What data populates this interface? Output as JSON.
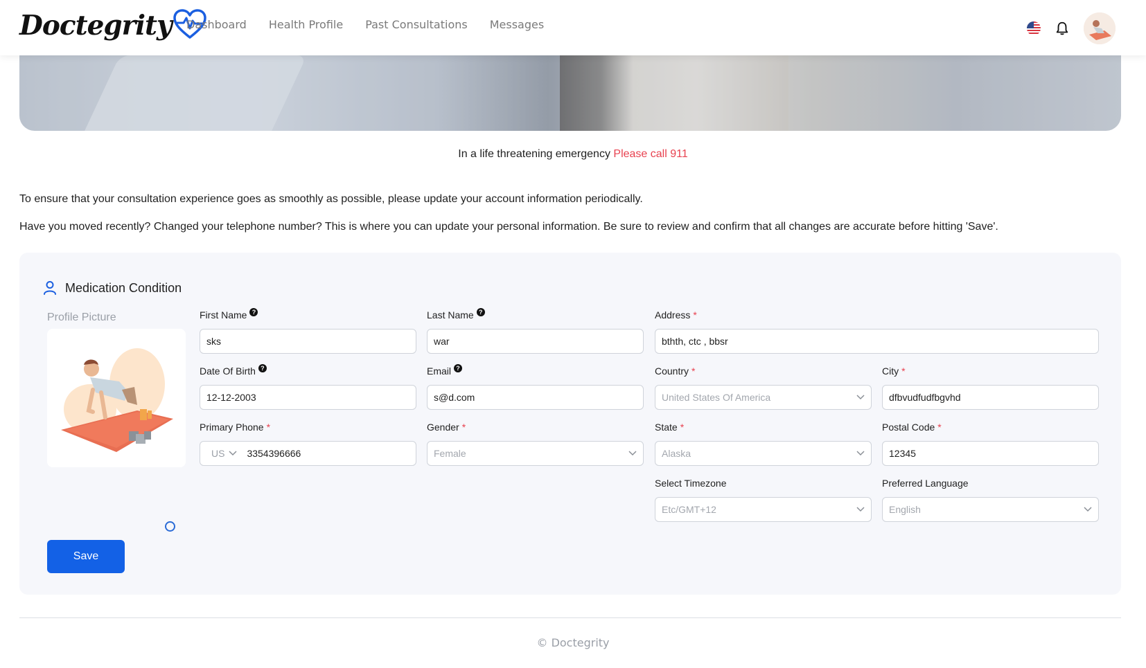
{
  "brand": {
    "name": "Doctegrity",
    "accent": "#1b5fe0"
  },
  "nav": {
    "items": [
      {
        "label": "Dashboard"
      },
      {
        "label": "Health Profile"
      },
      {
        "label": "Past Consultations"
      },
      {
        "label": "Messages"
      }
    ]
  },
  "header": {
    "flag_icon": "us-flag-icon",
    "bell_icon": "bell-icon",
    "avatar_icon": "user-avatar"
  },
  "emergency": {
    "text": "In a life threatening emergency",
    "call": "Please call 911"
  },
  "intro": {
    "line1": "To ensure that your consultation experience goes as smoothly as possible, please update your account information periodically.",
    "line2": "Have you moved recently? Changed your telephone number? This is where you can update your personal information. Be sure to review and confirm that all changes are accurate before hitting 'Save'."
  },
  "form": {
    "section_title": "Medication Condition",
    "profile_picture_label": "Profile Picture",
    "save_label": "Save",
    "first_name": {
      "label": "First Name",
      "value": "sks"
    },
    "last_name": {
      "label": "Last Name",
      "value": "war"
    },
    "address": {
      "label": "Address",
      "required": "*",
      "value": "bthth,  ctc , bbsr"
    },
    "dob": {
      "label": "Date Of Birth",
      "value": "12-12-2003"
    },
    "email": {
      "label": "Email",
      "value": "s@d.com"
    },
    "country": {
      "label": "Country",
      "required": "*",
      "value": "United States Of America"
    },
    "city": {
      "label": "City",
      "required": "*",
      "value": "dfbvudfudfbgvhd"
    },
    "phone": {
      "label": "Primary Phone",
      "required": "*",
      "country_code": "US",
      "value": "3354396666"
    },
    "gender": {
      "label": "Gender",
      "required": "*",
      "value": "Female"
    },
    "state": {
      "label": "State",
      "required": "*",
      "value": "Alaska"
    },
    "postal": {
      "label": "Postal Code",
      "required": "*",
      "value": "12345"
    },
    "timezone": {
      "label": "Select Timezone",
      "value": "Etc/GMT+12"
    },
    "language": {
      "label": "Preferred Language",
      "value": "English"
    }
  },
  "footer": {
    "text": "© Doctegrity"
  }
}
